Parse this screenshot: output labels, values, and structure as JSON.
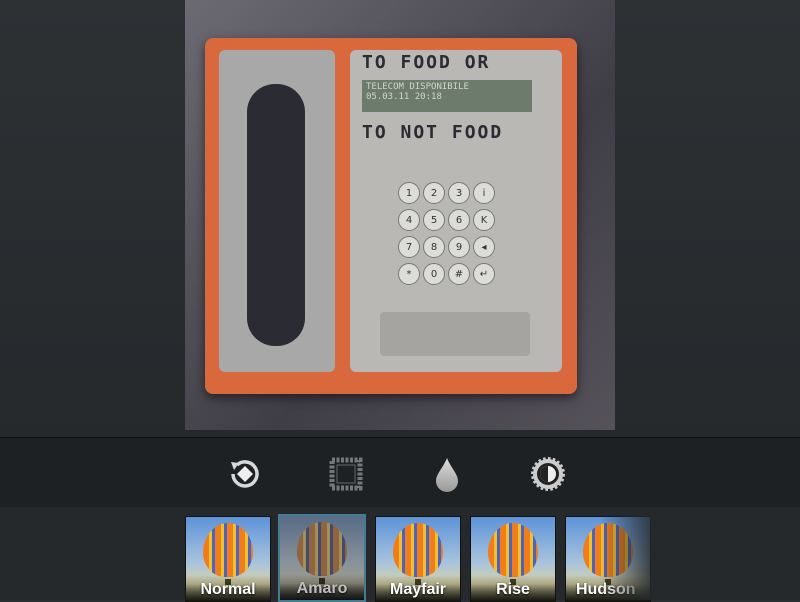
{
  "photo": {
    "scribble_top": "TO FOOD OR",
    "scribble_bottom": "TO NOT FOOD",
    "lcd_line1": "TELECOM DISPONIBILE",
    "lcd_line2": "05.03.11   20:18",
    "keys": [
      "1",
      "2",
      "3",
      "i",
      "4",
      "5",
      "6",
      "K",
      "7",
      "8",
      "9",
      "◂",
      "*",
      "0",
      "#",
      "↵"
    ]
  },
  "toolbar": {
    "tools": [
      {
        "icon": "rotate-icon"
      },
      {
        "icon": "frame-icon"
      },
      {
        "icon": "tilt-shift-drop-icon"
      },
      {
        "icon": "brightness-icon"
      }
    ]
  },
  "filters": {
    "selected": "Amaro",
    "accent": "#1fb3f0",
    "items": [
      {
        "label": "Normal"
      },
      {
        "label": "Amaro"
      },
      {
        "label": "Mayfair"
      },
      {
        "label": "Rise"
      },
      {
        "label": "Hudson"
      }
    ]
  }
}
